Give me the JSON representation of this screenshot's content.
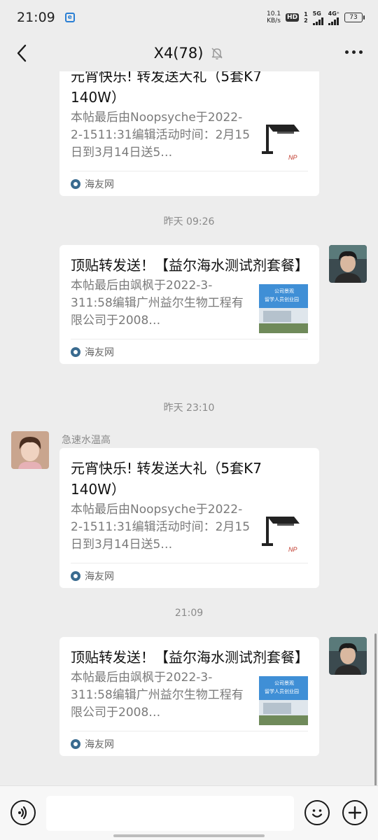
{
  "status_bar": {
    "time": "21:09",
    "speed_value": "10.1",
    "speed_unit": "KB/s",
    "hd_label": "HD",
    "hd_sub_1": "1",
    "hd_sub_2": "2",
    "net_1": "5G",
    "net_2": "4G⁺",
    "battery": "73"
  },
  "nav": {
    "title": "X4(78)",
    "icons": [
      "back-icon",
      "mute-bell-icon",
      "more-icon"
    ]
  },
  "messages": [
    {
      "type": "link-card",
      "sender_side": "left",
      "title": "元宵快乐! 转发送大礼（5套K7 140W）",
      "description": "本帖最后由Noopsyche于2022-2-1511:31编辑活动时间：2月15日到3月14日送5…",
      "source": "海友网",
      "thumb": "lamp"
    },
    {
      "type": "timestamp",
      "text": "昨天 09:26"
    },
    {
      "type": "link-card",
      "sender_side": "right",
      "title": "顶贴转发送！【益尔海水测试剂套餐】",
      "description": "本帖最后由飒枫于2022-3-311:58编辑广州益尔生物工程有限公司于2008…",
      "source": "海友网",
      "thumb": "building",
      "thumb_text_1": "公司景观",
      "thumb_text_2": "留学人员创业园"
    },
    {
      "type": "timestamp",
      "text": "昨天 23:10"
    },
    {
      "type": "link-card",
      "sender_side": "left",
      "sender_name": "急速水温高",
      "title": "元宵快乐! 转发送大礼（5套K7 140W）",
      "description": "本帖最后由Noopsyche于2022-2-1511:31编辑活动时间：2月15日到3月14日送5…",
      "source": "海友网",
      "thumb": "lamp"
    },
    {
      "type": "timestamp",
      "text": "21:09"
    },
    {
      "type": "link-card",
      "sender_side": "right",
      "title": "顶贴转发送！【益尔海水测试剂套餐】",
      "description": "本帖最后由飒枫于2022-3-311:58编辑广州益尔生物工程有限公司于2008…",
      "source": "海友网",
      "thumb": "building",
      "thumb_text_1": "公司景观",
      "thumb_text_2": "留学人员创业园"
    }
  ],
  "input_bar": {
    "icons": [
      "voice-icon",
      "emoji-icon",
      "plus-icon"
    ],
    "value": ""
  },
  "colors": {
    "background": "#ededed",
    "card": "#ffffff",
    "muted_text": "#7a7a7a",
    "source_icon": "#3a6b8f"
  }
}
